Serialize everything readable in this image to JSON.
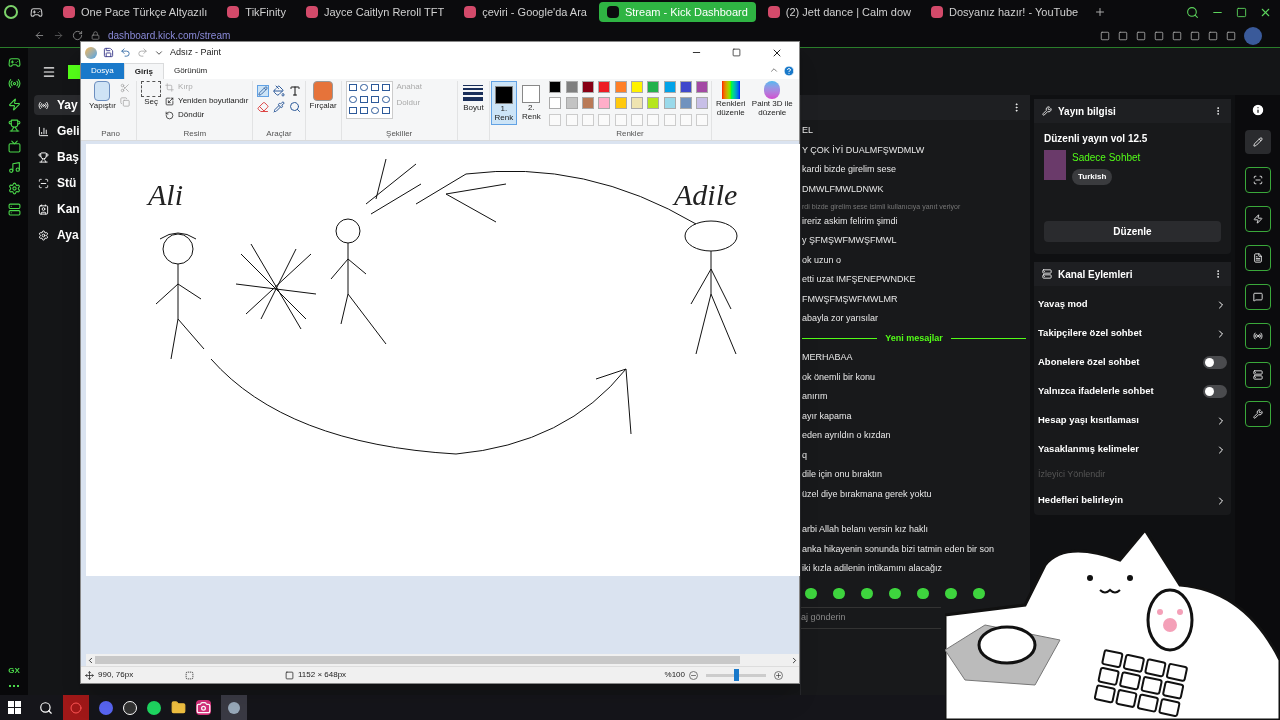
{
  "browser": {
    "tabs": [
      {
        "title": "One Pace Türkçe Altyazılı",
        "selected": false
      },
      {
        "title": "TikFinity",
        "selected": false
      },
      {
        "title": "Jayce Caitlyn Reroll TFT",
        "selected": false
      },
      {
        "title": "çeviri - Google'da Ara",
        "selected": false
      },
      {
        "title": "Stream - Kick Dashboard",
        "selected": true
      },
      {
        "title": "(2) Jett dance | Calm dow",
        "selected": false
      },
      {
        "title": "Dosyanız hazır! - YouTube",
        "selected": false
      }
    ],
    "url": "dashboard.kick.com/stream"
  },
  "opera_sidebar": {
    "badge": "GX"
  },
  "kick_nav": [
    {
      "label": "Yay",
      "selected": true
    },
    {
      "label": "Geli",
      "selected": false
    },
    {
      "label": "Baş",
      "selected": false
    },
    {
      "label": "Stü",
      "selected": false
    },
    {
      "label": "Kan",
      "selected": false
    },
    {
      "label": "Aya",
      "selected": false
    }
  ],
  "paint": {
    "title": "Adsız - Paint",
    "ribbon_tabs": [
      {
        "label": "Dosya",
        "kind": "file",
        "selected": false
      },
      {
        "label": "Giriş",
        "kind": "tab",
        "selected": true
      },
      {
        "label": "Görünüm",
        "kind": "tab",
        "selected": false
      }
    ],
    "clipboard": {
      "paste": "Yapıştır",
      "group": "Pano"
    },
    "image": {
      "select": "Seç",
      "crop": {
        "label": "Kırp",
        "disabled": true
      },
      "resize": {
        "label": "Yeniden boyutlandır",
        "disabled": false
      },
      "rotate": {
        "label": "Döndür",
        "disabled": false
      },
      "group": "Resim"
    },
    "tools": {
      "group": "Araçlar"
    },
    "brushes": "Fırçalar",
    "shapes": {
      "outline": {
        "label": "Anahat",
        "disabled": true
      },
      "fill": {
        "label": "Doldur",
        "disabled": true
      },
      "group": "Şekiller"
    },
    "size": "Boyut",
    "color1": {
      "label": "1. Renk",
      "color": "#000000",
      "selected": true
    },
    "color2": {
      "label": "2. Renk",
      "color": "#ffffff",
      "selected": false
    },
    "palette": [
      {
        "color": "#000000"
      },
      {
        "color": "#7f7f7f"
      },
      {
        "color": "#880015"
      },
      {
        "color": "#ed1c24"
      },
      {
        "color": "#ff7f27"
      },
      {
        "color": "#fff200"
      },
      {
        "color": "#22b14c"
      },
      {
        "color": "#00a2e8"
      },
      {
        "color": "#3f48cc"
      },
      {
        "color": "#a349a4"
      },
      {
        "color": "#ffffff"
      },
      {
        "color": "#c3c3c3"
      },
      {
        "color": "#b97a57"
      },
      {
        "color": "#ffaec9"
      },
      {
        "color": "#ffc90e"
      },
      {
        "color": "#efe4b0"
      },
      {
        "color": "#b5e61d"
      },
      {
        "color": "#99d9ea"
      },
      {
        "color": "#7092be"
      },
      {
        "color": "#c8bfe7"
      }
    ],
    "colors_group": "Renkler",
    "edit_colors": "Renkleri düzenle",
    "paint3d": "Paint 3D ile düzenle",
    "canvas_labels": [
      {
        "text": "Ali"
      },
      {
        "text": "Adile"
      }
    ],
    "status": {
      "cursor": "990, 76px",
      "size": "1152 × 648px",
      "zoom": "%100",
      "zoom_slider": {
        "level": 0.5
      }
    }
  },
  "chat": {
    "messages": [
      {
        "text": "EL",
        "kind": "message"
      },
      {
        "text": "Y ÇOK İYİ DUALMFŞWDMLW",
        "kind": "message"
      },
      {
        "text": "kardi bizde girelim sese",
        "kind": "message"
      },
      {
        "text": "DMWLFMWLDNWK",
        "kind": "message"
      },
      {
        "text": "rdi bizde girelim sese isimli kullanıcıya yanıt veriyor",
        "kind": "reply"
      },
      {
        "text": "ireriz askim felirim şimdi",
        "kind": "message"
      },
      {
        "text": "y ŞFMŞWFMWŞFMWL",
        "kind": "message"
      },
      {
        "text": "ok uzun o",
        "kind": "message"
      },
      {
        "text": "etti uzat IMFŞENEPWNDKE",
        "kind": "message"
      },
      {
        "text": "FMWŞFMŞWFMWLMR",
        "kind": "message"
      },
      {
        "text": "abayla zor yarısılar",
        "kind": "message"
      },
      {
        "text": "Yeni mesajlar",
        "kind": "divider"
      },
      {
        "text": "MERHABAA",
        "kind": "message"
      },
      {
        "text": "ok önemli bir konu",
        "kind": "message"
      },
      {
        "text": "anırım",
        "kind": "message"
      },
      {
        "text": "ayır kapama",
        "kind": "message"
      },
      {
        "text": "eden ayrıldın o kızdan",
        "kind": "message"
      },
      {
        "text": "q",
        "kind": "message"
      },
      {
        "text": "dile için onu bıraktın",
        "kind": "message"
      },
      {
        "text": "üzel diye bırakmana gerek yoktu",
        "kind": "message"
      },
      {
        "text": "arbi Allah belanı versin kız haklı",
        "kind": "message"
      },
      {
        "text": "anka hikayenin sonunda bizi tatmin eden bir son",
        "kind": "message"
      },
      {
        "text": "iki kızla adilenin intikamını alacağız",
        "kind": "message"
      }
    ],
    "placeholder": "aj gönderin"
  },
  "stream_info": {
    "heading": "Yayın bilgisi",
    "title": "Düzenli yayın vol 12.5",
    "category": "Sadece Sohbet",
    "tag": "Turkish",
    "button": "Düzenle"
  },
  "channel_actions": {
    "heading": "Kanal Eylemleri",
    "items": [
      {
        "label": "Yavaş mod",
        "kind": "link"
      },
      {
        "label": "Takipçilere özel sohbet",
        "kind": "link"
      },
      {
        "label": "Abonelere özel sohbet",
        "kind": "toggle",
        "on": false
      },
      {
        "label": "Yalnızca ifadelerle sohbet",
        "kind": "toggle",
        "on": false
      },
      {
        "label": "Hesap yaşı kısıtlaması",
        "kind": "link"
      },
      {
        "label": "Yasaklanmış kelimeler",
        "kind": "link"
      },
      {
        "label": "İzleyici Yönlendir",
        "kind": "section"
      },
      {
        "label": "Hedefleri belirleyin",
        "kind": "link"
      }
    ]
  }
}
